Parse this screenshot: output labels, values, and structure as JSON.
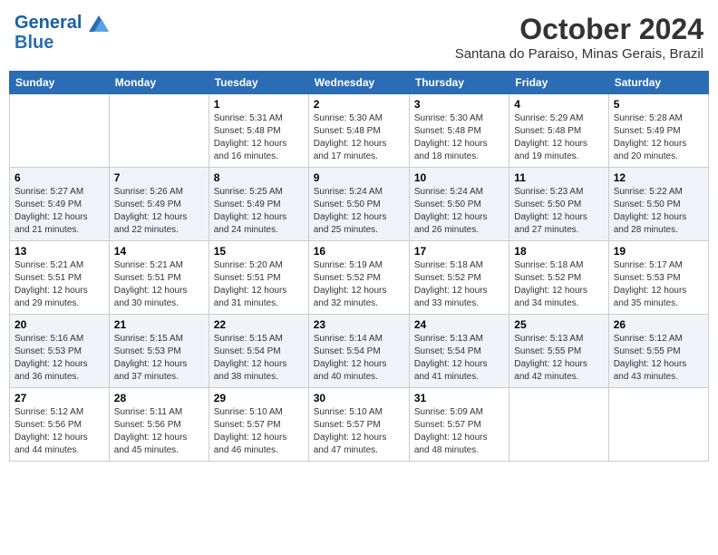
{
  "header": {
    "logo_line1": "General",
    "logo_line2": "Blue",
    "month_title": "October 2024",
    "subtitle": "Santana do Paraiso, Minas Gerais, Brazil"
  },
  "weekdays": [
    "Sunday",
    "Monday",
    "Tuesday",
    "Wednesday",
    "Thursday",
    "Friday",
    "Saturday"
  ],
  "weeks": [
    [
      {
        "day": "",
        "info": ""
      },
      {
        "day": "",
        "info": ""
      },
      {
        "day": "1",
        "info": "Sunrise: 5:31 AM\nSunset: 5:48 PM\nDaylight: 12 hours\nand 16 minutes."
      },
      {
        "day": "2",
        "info": "Sunrise: 5:30 AM\nSunset: 5:48 PM\nDaylight: 12 hours\nand 17 minutes."
      },
      {
        "day": "3",
        "info": "Sunrise: 5:30 AM\nSunset: 5:48 PM\nDaylight: 12 hours\nand 18 minutes."
      },
      {
        "day": "4",
        "info": "Sunrise: 5:29 AM\nSunset: 5:48 PM\nDaylight: 12 hours\nand 19 minutes."
      },
      {
        "day": "5",
        "info": "Sunrise: 5:28 AM\nSunset: 5:49 PM\nDaylight: 12 hours\nand 20 minutes."
      }
    ],
    [
      {
        "day": "6",
        "info": "Sunrise: 5:27 AM\nSunset: 5:49 PM\nDaylight: 12 hours\nand 21 minutes."
      },
      {
        "day": "7",
        "info": "Sunrise: 5:26 AM\nSunset: 5:49 PM\nDaylight: 12 hours\nand 22 minutes."
      },
      {
        "day": "8",
        "info": "Sunrise: 5:25 AM\nSunset: 5:49 PM\nDaylight: 12 hours\nand 24 minutes."
      },
      {
        "day": "9",
        "info": "Sunrise: 5:24 AM\nSunset: 5:50 PM\nDaylight: 12 hours\nand 25 minutes."
      },
      {
        "day": "10",
        "info": "Sunrise: 5:24 AM\nSunset: 5:50 PM\nDaylight: 12 hours\nand 26 minutes."
      },
      {
        "day": "11",
        "info": "Sunrise: 5:23 AM\nSunset: 5:50 PM\nDaylight: 12 hours\nand 27 minutes."
      },
      {
        "day": "12",
        "info": "Sunrise: 5:22 AM\nSunset: 5:50 PM\nDaylight: 12 hours\nand 28 minutes."
      }
    ],
    [
      {
        "day": "13",
        "info": "Sunrise: 5:21 AM\nSunset: 5:51 PM\nDaylight: 12 hours\nand 29 minutes."
      },
      {
        "day": "14",
        "info": "Sunrise: 5:21 AM\nSunset: 5:51 PM\nDaylight: 12 hours\nand 30 minutes."
      },
      {
        "day": "15",
        "info": "Sunrise: 5:20 AM\nSunset: 5:51 PM\nDaylight: 12 hours\nand 31 minutes."
      },
      {
        "day": "16",
        "info": "Sunrise: 5:19 AM\nSunset: 5:52 PM\nDaylight: 12 hours\nand 32 minutes."
      },
      {
        "day": "17",
        "info": "Sunrise: 5:18 AM\nSunset: 5:52 PM\nDaylight: 12 hours\nand 33 minutes."
      },
      {
        "day": "18",
        "info": "Sunrise: 5:18 AM\nSunset: 5:52 PM\nDaylight: 12 hours\nand 34 minutes."
      },
      {
        "day": "19",
        "info": "Sunrise: 5:17 AM\nSunset: 5:53 PM\nDaylight: 12 hours\nand 35 minutes."
      }
    ],
    [
      {
        "day": "20",
        "info": "Sunrise: 5:16 AM\nSunset: 5:53 PM\nDaylight: 12 hours\nand 36 minutes."
      },
      {
        "day": "21",
        "info": "Sunrise: 5:15 AM\nSunset: 5:53 PM\nDaylight: 12 hours\nand 37 minutes."
      },
      {
        "day": "22",
        "info": "Sunrise: 5:15 AM\nSunset: 5:54 PM\nDaylight: 12 hours\nand 38 minutes."
      },
      {
        "day": "23",
        "info": "Sunrise: 5:14 AM\nSunset: 5:54 PM\nDaylight: 12 hours\nand 40 minutes."
      },
      {
        "day": "24",
        "info": "Sunrise: 5:13 AM\nSunset: 5:54 PM\nDaylight: 12 hours\nand 41 minutes."
      },
      {
        "day": "25",
        "info": "Sunrise: 5:13 AM\nSunset: 5:55 PM\nDaylight: 12 hours\nand 42 minutes."
      },
      {
        "day": "26",
        "info": "Sunrise: 5:12 AM\nSunset: 5:55 PM\nDaylight: 12 hours\nand 43 minutes."
      }
    ],
    [
      {
        "day": "27",
        "info": "Sunrise: 5:12 AM\nSunset: 5:56 PM\nDaylight: 12 hours\nand 44 minutes."
      },
      {
        "day": "28",
        "info": "Sunrise: 5:11 AM\nSunset: 5:56 PM\nDaylight: 12 hours\nand 45 minutes."
      },
      {
        "day": "29",
        "info": "Sunrise: 5:10 AM\nSunset: 5:57 PM\nDaylight: 12 hours\nand 46 minutes."
      },
      {
        "day": "30",
        "info": "Sunrise: 5:10 AM\nSunset: 5:57 PM\nDaylight: 12 hours\nand 47 minutes."
      },
      {
        "day": "31",
        "info": "Sunrise: 5:09 AM\nSunset: 5:57 PM\nDaylight: 12 hours\nand 48 minutes."
      },
      {
        "day": "",
        "info": ""
      },
      {
        "day": "",
        "info": ""
      }
    ]
  ]
}
